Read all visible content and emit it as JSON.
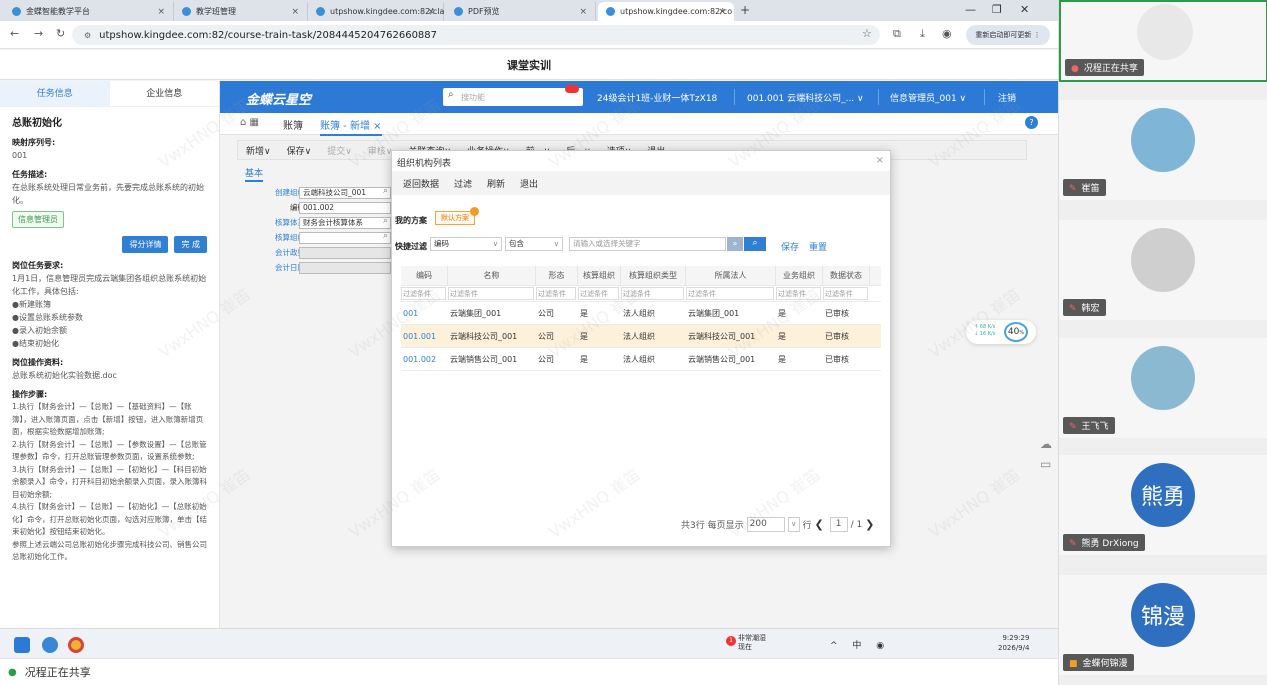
{
  "browser": {
    "tabs": [
      {
        "label": "金蝶智能教学平台"
      },
      {
        "label": "教学班管理"
      },
      {
        "label": "utpshow.kingdee.com:82/cla"
      },
      {
        "label": "PDF预览"
      },
      {
        "label": "utpshow.kingdee.com:82/co"
      }
    ],
    "url": "utpshow.kingdee.com:82/course-train-task/2084445204762660887",
    "relaunch_label": "重新启动即可更新"
  },
  "page_title": "课堂实训",
  "left_panel": {
    "tab_task": "任务信息",
    "tab_company": "企业信息",
    "heading": "总账初始化",
    "seq_label": "映射序列号:",
    "seq_value": "001",
    "desc_label": "任务描述:",
    "desc_text": "在总账系统处理日常业务前，先要完成总账系统的初始化。",
    "role_tag": "信息管理员",
    "score_btn": "得分详情",
    "done_btn": "完 成",
    "req_label": "岗位任务要求:",
    "req_text": "1月1日，信息管理员完成云端集团各组织总账系统初始化工作，具体包括:",
    "req_items": [
      "●新建账簿",
      "●设置总账系统参数",
      "●录入初始余额",
      "●结束初始化"
    ],
    "material_label": "岗位操作资料:",
    "material_file": "总账系统初始化实验数据.doc",
    "steps_label": "操作步骤:",
    "steps_text": "1.执行【财务会计】—【总账】—【基础资料】—【账簿】，进入账簿页面，点击【新增】按钮，进入账簿新增页面，根据实验数据增加账簿;\n2.执行【财务会计】—【总账】—【参数设置】—【总账管理参数】命令，打开总账管理参数页面，设置系统参数;\n3.执行【财务会计】—【总账】—【初始化】—【科目初始余额录入】命令，打开科目初始余额录入页面，录入账簿科目初始余额;\n4.执行【财务会计】—【总账】—【初始化】—【总账初始化】命令，打开总账初始化页面，勾选对应账簿，单击【结束初始化】按钮结束初始化。\n参照上述云端公司总账初始化步骤完成科技公司、销售公司总账初始化工作。"
  },
  "app": {
    "logo": "金蝶云星空",
    "search_placeholder": "搜功能",
    "class_info": "24级会计1班-业财一体TzX18",
    "org_info": "001.001 云端科技公司_...",
    "user_info": "信息管理员_001",
    "logout": "注销",
    "nav_home": "账簿",
    "nav_active": "账簿 - 新增",
    "toolbar": [
      "新增∨",
      "保存∨",
      "提交∨",
      "审核∨",
      "关联查询∨",
      "业务操作∨",
      "前一∨",
      "后一∨",
      "选项∨",
      "退出"
    ],
    "form_tab": "基本",
    "form": [
      {
        "label": "创建组织",
        "value": "云端科技公司_001",
        "lookup": true
      },
      {
        "label": "编码",
        "value": "001.002",
        "lookup": false
      },
      {
        "label": "核算体系",
        "value": "财务会计核算体系",
        "lookup": true
      },
      {
        "label": "核算组织",
        "value": "",
        "lookup": true
      },
      {
        "label": "会计政策",
        "value": "",
        "lookup": false
      },
      {
        "label": "会计日历",
        "value": "",
        "lookup": false
      }
    ]
  },
  "dialog": {
    "title": "组织机构列表",
    "tools": [
      "返回数据",
      "过滤",
      "刷新",
      "退出"
    ],
    "my_scheme_label": "我的方案",
    "default_scheme": "默认方案",
    "quick_filter_label": "快捷过滤",
    "filter_field": "编码",
    "filter_op": "包含",
    "filter_placeholder": "请输入或选择关键字",
    "save": "保存",
    "reset": "重置",
    "columns": [
      "编码",
      "名称",
      "形态",
      "核算组织",
      "核算组织类型",
      "所属法人",
      "业务组织",
      "数据状态"
    ],
    "filter_cell": "过滤条件",
    "rows": [
      [
        "001",
        "云端集团_001",
        "公司",
        "是",
        "法人组织",
        "云端集团_001",
        "是",
        "已审核"
      ],
      [
        "001.001",
        "云端科技公司_001",
        "公司",
        "是",
        "法人组织",
        "云端科技公司_001",
        "是",
        "已审核"
      ],
      [
        "001.002",
        "云端销售公司_001",
        "公司",
        "是",
        "法人组织",
        "云端销售公司_001",
        "是",
        "已审核"
      ]
    ],
    "selected_row": 1,
    "pager": {
      "total": "共3行",
      "per_page_label": "每页显示",
      "per_page": "200",
      "row_unit": "行",
      "page": "1",
      "pages": "/ 1"
    }
  },
  "speed": {
    "up": "↑ 68 K/s",
    "down": "↓ 16 K/s",
    "pct": "40"
  },
  "taskbar": {
    "weather_line1": "非常潮湿",
    "weather_line2": "现在",
    "weather_badge": "1",
    "tray_text": "^ 中 ◉",
    "time": "9:29:29",
    "date": "2026/9/4"
  },
  "sharebar": {
    "label": "况程正在共享"
  },
  "meeting": {
    "participants": [
      {
        "name": "况程正在共享",
        "initials": "",
        "color": "#ffffff"
      },
      {
        "name": "崔笛",
        "initials": "",
        "color": "#7fb5d6"
      },
      {
        "name": "韩宏",
        "initials": "",
        "color": "#d9d9d9"
      },
      {
        "name": "王飞飞",
        "initials": "",
        "color": "#8bb9d1"
      },
      {
        "name": "熊勇 DrXiong",
        "initials": "熊勇",
        "color": "#2f6fbf"
      },
      {
        "name": "金蝶何锦漫",
        "initials": "锦漫",
        "color": "#2f6fbf"
      }
    ]
  },
  "watermark": "VwxHNQ 崔笛"
}
